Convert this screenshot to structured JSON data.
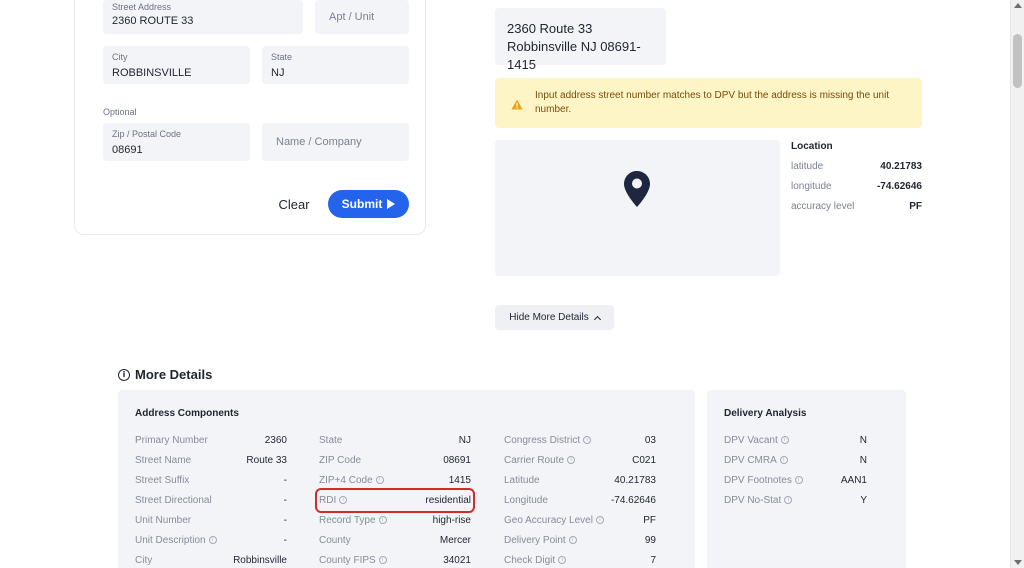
{
  "form": {
    "street_address": {
      "label": "Street Address",
      "value": "2360 ROUTE 33"
    },
    "apt_unit": {
      "placeholder": "Apt / Unit"
    },
    "city": {
      "label": "City",
      "value": "ROBBINSVILLE"
    },
    "state": {
      "label": "State",
      "value": "NJ"
    },
    "optional_label": "Optional",
    "zip": {
      "label": "Zip / Postal Code",
      "value": "08691"
    },
    "name_company": {
      "placeholder": "Name / Company"
    },
    "clear_label": "Clear",
    "submit_label": "Submit"
  },
  "result": {
    "address_line1": "2360 Route 33",
    "address_line2": "Robbinsville NJ 08691-1415",
    "warning_text": "Input address street number matches to DPV but the address is missing the unit number.",
    "location": {
      "title": "Location",
      "rows": [
        {
          "key": "latitude",
          "value": "40.21783"
        },
        {
          "key": "longitude",
          "value": "-74.62646"
        },
        {
          "key": "accuracy level",
          "value": "PF"
        }
      ]
    },
    "hide_more_details_label": "Hide More Details"
  },
  "more_details": {
    "title": "More Details",
    "address_components": {
      "title": "Address Components",
      "col1": [
        {
          "key": "Primary Number",
          "value": "2360",
          "info": false
        },
        {
          "key": "Street Name",
          "value": "Route 33",
          "info": false
        },
        {
          "key": "Street Suffix",
          "value": "-",
          "info": false
        },
        {
          "key": "Street Directional",
          "value": "-",
          "info": false
        },
        {
          "key": "Unit Number",
          "value": "-",
          "info": false
        },
        {
          "key": "Unit Description",
          "value": "-",
          "info": true
        },
        {
          "key": "City",
          "value": "Robbinsville",
          "info": false
        }
      ],
      "col2": [
        {
          "key": "State",
          "value": "NJ",
          "info": false
        },
        {
          "key": "ZIP Code",
          "value": "08691",
          "info": false
        },
        {
          "key": "ZIP+4 Code",
          "value": "1415",
          "info": true
        },
        {
          "key": "RDI",
          "value": "residential",
          "info": true
        },
        {
          "key": "Record Type",
          "value": "high-rise",
          "info": true
        },
        {
          "key": "County",
          "value": "Mercer",
          "info": false
        },
        {
          "key": "County FIPS",
          "value": "34021",
          "info": true
        }
      ],
      "col3": [
        {
          "key": "Congress District",
          "value": "03",
          "info": true
        },
        {
          "key": "Carrier Route",
          "value": "C021",
          "info": true
        },
        {
          "key": "Latitude",
          "value": "40.21783",
          "info": false
        },
        {
          "key": "Longitude",
          "value": "-74.62646",
          "info": false
        },
        {
          "key": "Geo Accuracy Level",
          "value": "PF",
          "info": true
        },
        {
          "key": "Delivery Point",
          "value": "99",
          "info": true
        },
        {
          "key": "Check Digit",
          "value": "7",
          "info": true
        }
      ]
    },
    "delivery_analysis": {
      "title": "Delivery Analysis",
      "rows": [
        {
          "key": "DPV Vacant",
          "value": "N",
          "info": true
        },
        {
          "key": "DPV CMRA",
          "value": "N",
          "info": true
        },
        {
          "key": "DPV Footnotes",
          "value": "AAN1",
          "info": true
        },
        {
          "key": "DPV No-Stat",
          "value": "Y",
          "info": true
        }
      ]
    }
  },
  "colors": {
    "accent": "#2463eb",
    "warning_bg": "#fdf5c5",
    "warning_text": "#7a4b0c",
    "highlight": "#d52a2a",
    "panel_bg": "#f3f4f7"
  },
  "icons": {
    "warning": "warning-triangle-icon",
    "map_pin": "map-pin-icon",
    "info": "info-circle-icon",
    "submit": "play-arrow-icon",
    "chevron": "chevron-up-icon"
  }
}
